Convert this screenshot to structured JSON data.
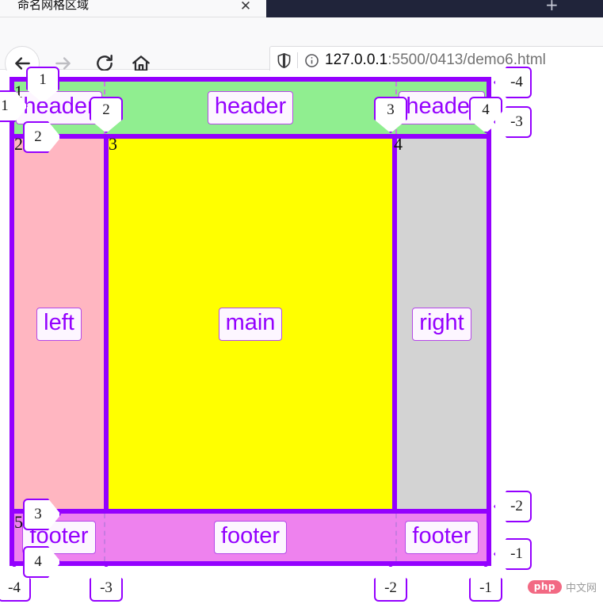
{
  "browser": {
    "tab_title": "命名网格区域",
    "close_label": "✕",
    "newtab_label": "+",
    "back_icon": "back-arrow-icon",
    "forward_icon": "forward-arrow-icon",
    "reload_icon": "reload-icon",
    "home_icon": "home-icon",
    "shield_icon": "shield-icon",
    "info_icon": "info-circle-icon",
    "url_host": "127.0.0.1",
    "url_path": ":5500/0413/demo6.html",
    "url_full": "127.0.0.1:5500/0413/demo6.html"
  },
  "grid": {
    "areas": {
      "header": "header",
      "left": "left",
      "main": "main",
      "right": "right",
      "footer": "footer"
    },
    "colors": {
      "header_bg": "#90ee90",
      "left_bg": "#ffb6c1",
      "main_bg": "#ffff00",
      "right_bg": "#d3d3d3",
      "footer_bg": "#ee82ee",
      "grid_line": "#9400ff",
      "chip_text": "#9400ff"
    },
    "column_lines_positive": [
      "1",
      "2",
      "3",
      "4"
    ],
    "column_lines_negative": [
      "-4",
      "-3",
      "-2",
      "-1"
    ],
    "row_lines_positive": [
      "1",
      "2",
      "3",
      "4"
    ],
    "row_lines_negative": [
      "-4",
      "-3",
      "-2",
      "-1"
    ],
    "inline_numbers": {
      "r1c1": "1",
      "r2c1": "2",
      "r2c2": "3",
      "r2c3": "4",
      "r3c1": "5"
    }
  },
  "watermark": {
    "badge": "php",
    "text": "中文网"
  }
}
